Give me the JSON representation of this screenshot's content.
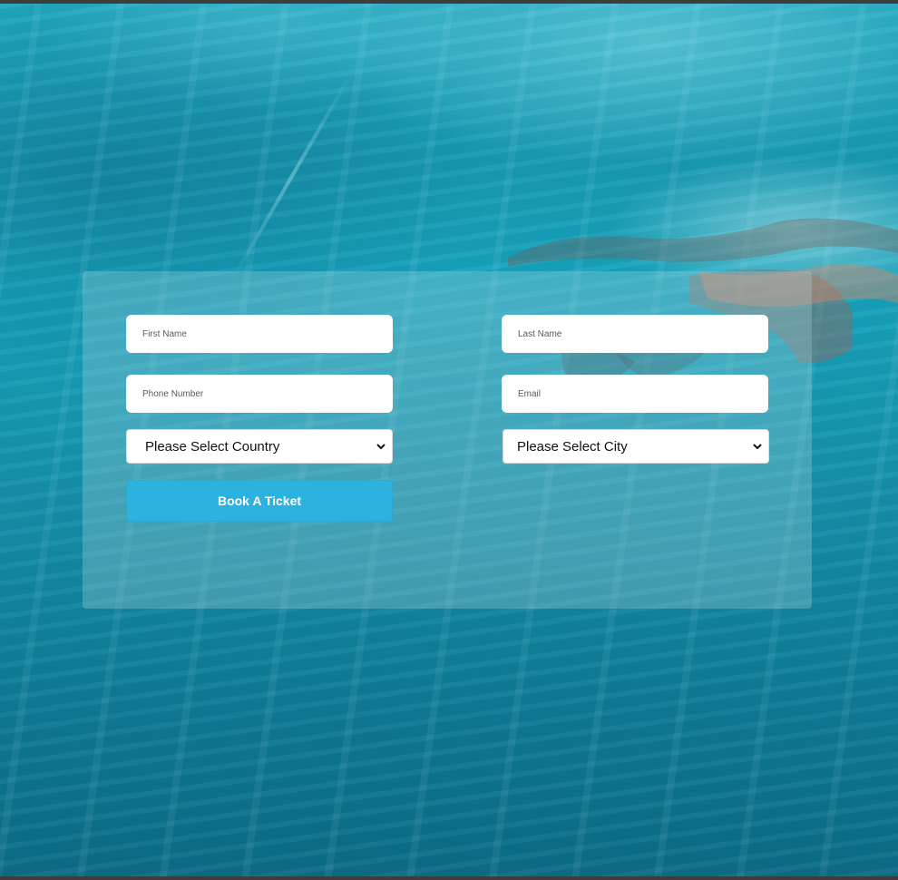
{
  "form": {
    "first_name_placeholder": "First Name",
    "last_name_placeholder": "Last Name",
    "phone_placeholder": "Phone Number",
    "email_placeholder": "Email",
    "country_selected": "Please Select Country",
    "city_selected": "Please Select City",
    "submit_label": "Book A Ticket"
  },
  "colors": {
    "button": "#2db1de",
    "background": "#17a3bd",
    "panel": "rgba(175,215,222,0.30)"
  },
  "icons": {
    "select_arrow": "chevron-down-icon"
  }
}
